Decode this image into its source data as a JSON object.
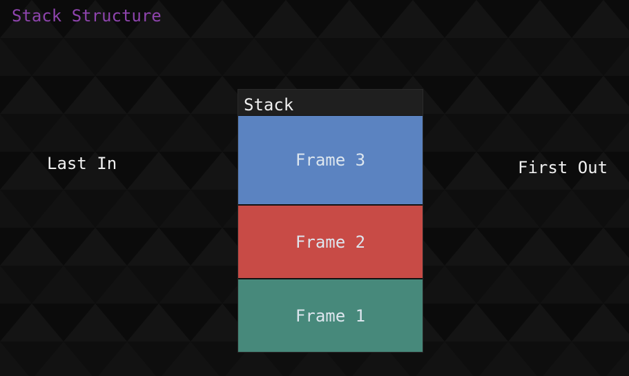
{
  "title": "Stack Structure",
  "labels": {
    "left": "Last In",
    "right": "First Out"
  },
  "stack": {
    "header": "Stack",
    "frames": [
      {
        "label": "Frame 3",
        "color": "#5b83c1"
      },
      {
        "label": "Frame 2",
        "color": "#c84b46"
      },
      {
        "label": "Frame 1",
        "color": "#47897b"
      }
    ]
  },
  "colors": {
    "background": "#0b0b0b",
    "title": "#8e44ad",
    "text": "#f0f0f0"
  }
}
